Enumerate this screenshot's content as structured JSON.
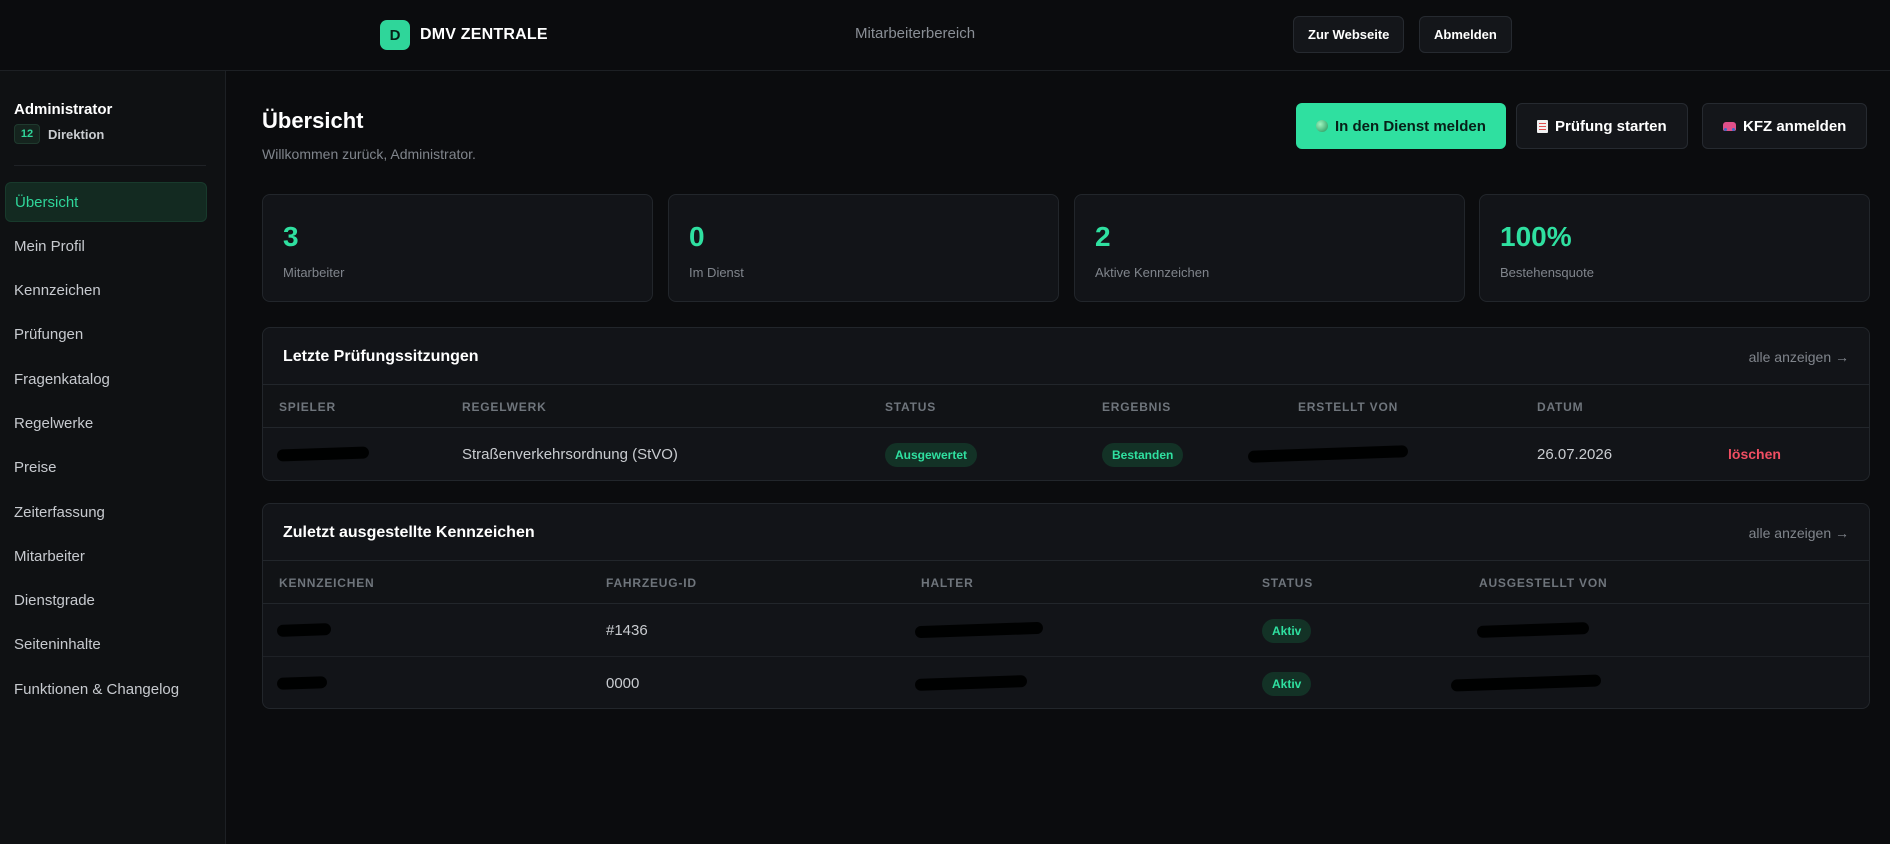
{
  "topbar": {
    "logo_letter": "D",
    "brand": "DMV ZENTRALE",
    "center": "Mitarbeiterbereich",
    "website_button": "Zur Webseite",
    "logout_button": "Abmelden"
  },
  "sidebar": {
    "user_name": "Administrator",
    "rank_number": "12",
    "rank_label": "Direktion",
    "items": [
      {
        "label": "Übersicht"
      },
      {
        "label": "Mein Profil"
      },
      {
        "label": "Kennzeichen"
      },
      {
        "label": "Prüfungen"
      },
      {
        "label": "Fragenkatalog"
      },
      {
        "label": "Regelwerke"
      },
      {
        "label": "Preise"
      },
      {
        "label": "Zeiterfassung"
      },
      {
        "label": "Mitarbeiter"
      },
      {
        "label": "Dienstgrade"
      },
      {
        "label": "Seiteninhalte"
      },
      {
        "label": "Funktionen & Changelog"
      }
    ]
  },
  "main": {
    "title": "Übersicht",
    "subtitle": "Willkommen zurück, Administrator.",
    "actions": {
      "duty": "In den Dienst melden",
      "exam": "Prüfung starten",
      "vehicle": "KFZ anmelden"
    },
    "stats": [
      {
        "value": "3",
        "label": "Mitarbeiter"
      },
      {
        "value": "0",
        "label": "Im Dienst"
      },
      {
        "value": "2",
        "label": "Aktive Kennzeichen"
      },
      {
        "value": "100%",
        "label": "Bestehensquote"
      }
    ],
    "exams": {
      "title": "Letzte Prüfungssitzungen",
      "link": "alle anzeigen →",
      "headers": [
        "SPIELER",
        "REGELWERK",
        "STATUS",
        "ERGEBNIS",
        "ERSTELLT VON",
        "DATUM"
      ],
      "rows": [
        {
          "regelwerk": "Straßenverkehrsordnung (StVO)",
          "status": "Ausgewertet",
          "ergebnis": "Bestanden",
          "datum": "26.07.2026",
          "action": "löschen"
        }
      ]
    },
    "plates": {
      "title": "Zuletzt ausgestellte Kennzeichen",
      "link": "alle anzeigen →",
      "headers": [
        "KENNZEICHEN",
        "FAHRZEUG-ID",
        "HALTER",
        "STATUS",
        "AUSGESTELLT VON"
      ],
      "rows": [
        {
          "vehicle_id": "#1436",
          "status": "Aktiv"
        },
        {
          "vehicle_id": "0000",
          "status": "Aktiv"
        }
      ]
    }
  },
  "colors": {
    "accent": "#2fe0a0",
    "danger": "#f04e62",
    "background": "#0b0c0e",
    "card": "#121418"
  }
}
